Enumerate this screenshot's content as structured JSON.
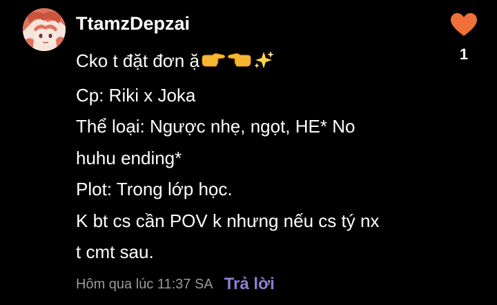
{
  "comment": {
    "username": "TtamzDepzai",
    "lines": [
      "Cko t đặt đơn ặ",
      "Cp: Riki x Joka",
      "Thể loại: Ngược nhẹ, ngọt, HE* No",
      "huhu ending*",
      "Plot: Trong lớp học.",
      "K bt cs cần POV k nhưng nếu cs tý nx",
      "t cmt sau."
    ],
    "line1_emojis": [
      "pointing-right-hand-icon",
      "pointing-left-hand-icon",
      "sparkles-icon"
    ],
    "timestamp": "Hôm qua lúc 11:37 SA",
    "reply_label": "Trả lời",
    "like_count": "1"
  },
  "colors": {
    "background": "#000000",
    "text": "#ffffff",
    "muted": "#9a9a9a",
    "reply": "#8f7fd0",
    "heart": "#f0703a"
  }
}
